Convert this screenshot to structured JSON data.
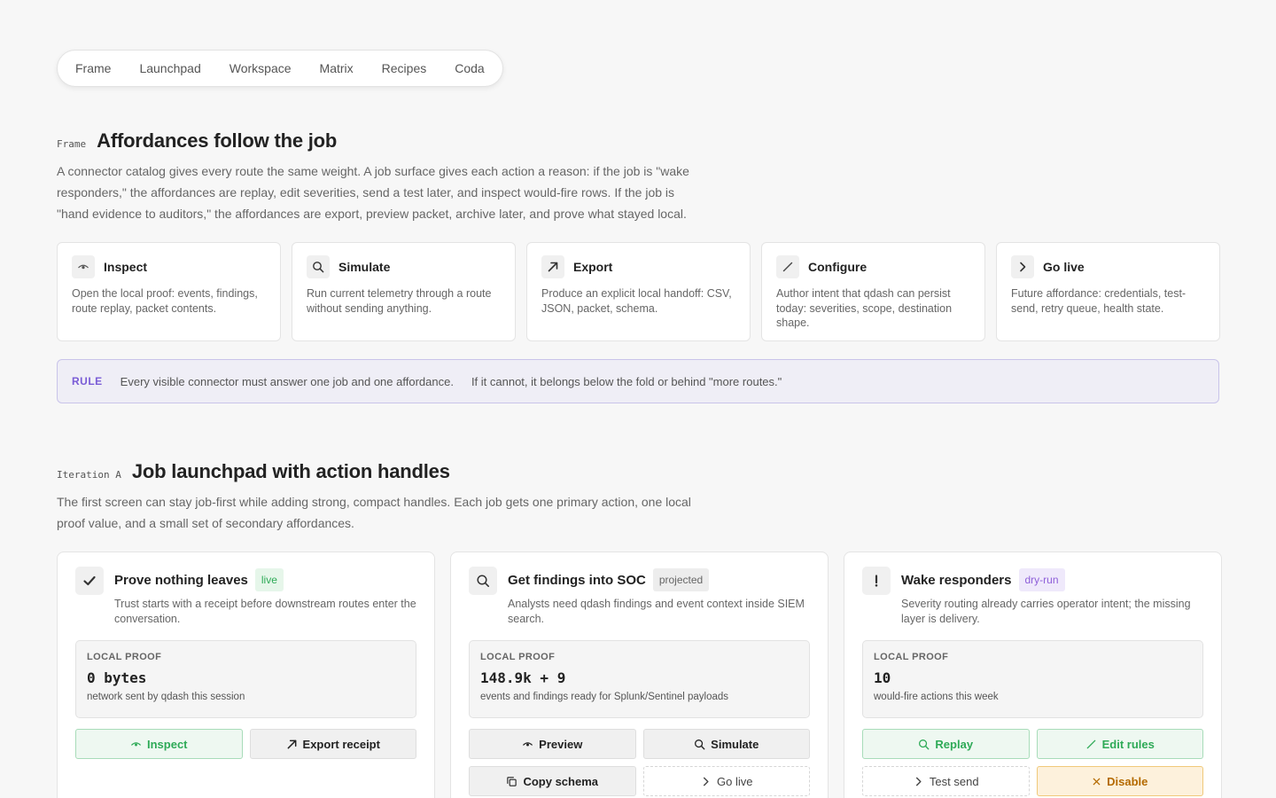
{
  "nav": [
    "Frame",
    "Launchpad",
    "Workspace",
    "Matrix",
    "Recipes",
    "Coda"
  ],
  "frame": {
    "eyebrow": "Frame",
    "title": "Affordances follow the job",
    "lead": "A connector catalog gives every route the same weight. A job surface gives each action a reason: if the job is \"wake responders,\" the affordances are replay, edit severities, send a test later, and inspect would-fire rows. If the job is \"hand evidence to auditors,\" the affordances are export, preview packet, archive later, and prove what stayed local."
  },
  "affordances": [
    {
      "title": "Inspect",
      "icon": "eye-icon",
      "desc": "Open the local proof: events, findings, route replay, packet contents."
    },
    {
      "title": "Simulate",
      "icon": "search-icon",
      "desc": "Run current telemetry through a route without sending anything."
    },
    {
      "title": "Export",
      "icon": "arrow-up-right-icon",
      "desc": "Produce an explicit local handoff: CSV, JSON, packet, schema."
    },
    {
      "title": "Configure",
      "icon": "pencil-icon",
      "desc": "Author intent that qdash can persist today: severities, scope, destination shape."
    },
    {
      "title": "Go live",
      "icon": "chevron-right-icon",
      "desc": "Future affordance: credentials, test-send, retry queue, health state."
    }
  ],
  "rule": {
    "tag": "RULE",
    "text_a": "Every visible connector must answer one job and one affordance.",
    "text_b": "If it cannot, it belongs below the fold or behind \"more routes.\""
  },
  "iteration": {
    "eyebrow": "Iteration A",
    "title": "Job launchpad with action handles",
    "lead": "The first screen can stay job-first while adding strong, compact handles. Each job gets one primary action, one local proof value, and a small set of secondary affordances."
  },
  "jobs": [
    {
      "title": "Prove nothing leaves",
      "badge": "live",
      "icon": "check-icon",
      "desc": "Trust starts with a receipt before downstream routes enter the conversation.",
      "proof_label": "LOCAL PROOF",
      "proof_value": "0 bytes",
      "proof_sub": "network sent by qdash this session",
      "buttons": [
        {
          "label": "Inspect",
          "icon": "eye-icon"
        },
        {
          "label": "Export receipt",
          "icon": "arrow-up-right-icon"
        }
      ]
    },
    {
      "title": "Get findings into SOC",
      "badge": "projected",
      "icon": "search-icon",
      "desc": "Analysts need qdash findings and event context inside SIEM search.",
      "proof_label": "LOCAL PROOF",
      "proof_value": "148.9k + 9",
      "proof_sub": "events and findings ready for Splunk/Sentinel payloads",
      "buttons": [
        {
          "label": "Preview",
          "icon": "eye-icon"
        },
        {
          "label": "Simulate",
          "icon": "search-icon"
        },
        {
          "label": "Copy schema",
          "icon": "copy-icon"
        },
        {
          "label": "Go live",
          "icon": "chevron-right-icon"
        }
      ]
    },
    {
      "title": "Wake responders",
      "badge": "dry-run",
      "icon": "exclamation-icon",
      "desc": "Severity routing already carries operator intent; the missing layer is delivery.",
      "proof_label": "LOCAL PROOF",
      "proof_value": "10",
      "proof_sub": "would-fire actions this week",
      "buttons": [
        {
          "label": "Replay",
          "icon": "search-icon"
        },
        {
          "label": "Edit rules",
          "icon": "pencil-icon"
        },
        {
          "label": "Test send",
          "icon": "chevron-right-icon"
        },
        {
          "label": "Disable",
          "icon": "close-icon"
        }
      ]
    }
  ],
  "colors": {
    "accent_green": "#2eaa57",
    "accent_purple": "#7a5cd6",
    "warn": "#b46a00"
  }
}
